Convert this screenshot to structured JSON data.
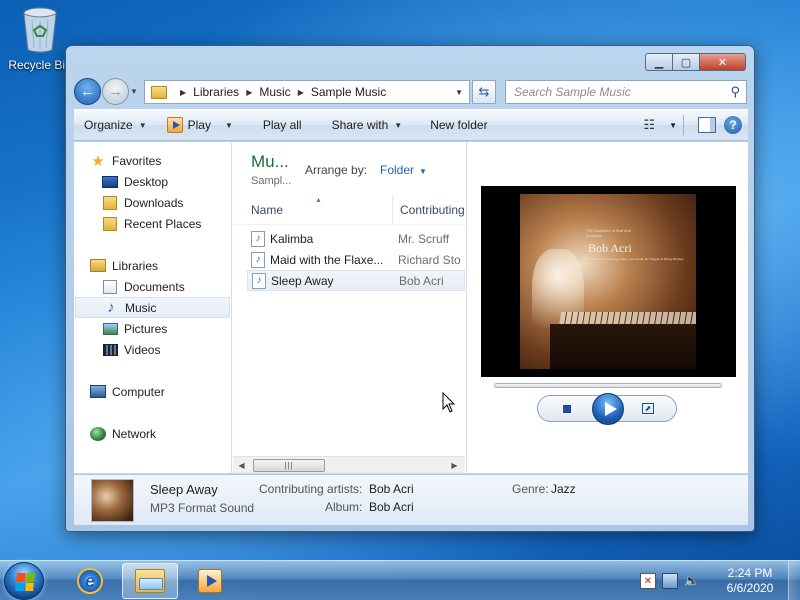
{
  "desktop": {
    "recycle_bin_label": "Recycle Bin"
  },
  "window": {
    "address": {
      "crumbs": [
        "Libraries",
        "Music",
        "Sample Music"
      ]
    },
    "search": {
      "placeholder": "Search Sample Music"
    },
    "toolbar": {
      "organize": "Organize",
      "play": "Play",
      "play_all": "Play all",
      "share_with": "Share with",
      "new_folder": "New folder"
    },
    "nav": {
      "favorites": "Favorites",
      "desktop": "Desktop",
      "downloads": "Downloads",
      "recent_places": "Recent Places",
      "libraries": "Libraries",
      "documents": "Documents",
      "music": "Music",
      "pictures": "Pictures",
      "videos": "Videos",
      "computer": "Computer",
      "network": "Network"
    },
    "library": {
      "title": "Mu...",
      "subtitle": "Sampl...",
      "arrange_by_label": "Arrange by:",
      "arrange_by_value": "Folder"
    },
    "columns": {
      "name": "Name",
      "contributing": "Contributing"
    },
    "files": [
      {
        "name": "Kalimba",
        "artist": "Mr. Scruff"
      },
      {
        "name": "Maid with the Flaxe...",
        "artist": "Richard Stoltzman"
      },
      {
        "name": "Sleep Away",
        "artist": "Bob Acri"
      }
    ],
    "selected_index": 2,
    "preview": {
      "album_artist": "Bob Acri",
      "album_small_top": "The Evolution of Bob Acri presents",
      "album_small_bottom": "with Glenn Ordin, George Mraz, Lew Soloff, Ed Thigpen & Randy Brecker"
    },
    "details": {
      "title": "Sleep Away",
      "type": "MP3 Format Sound",
      "contributing_label": "Contributing artists:",
      "contributing_value": "Bob Acri",
      "album_label": "Album:",
      "album_value": "Bob Acri",
      "genre_label": "Genre:",
      "genre_value": "Jazz"
    }
  },
  "taskbar": {
    "time": "2:24 PM",
    "date": "6/6/2020"
  },
  "colors": {
    "library_title": "#1e6b3a",
    "link_blue": "#2064b0",
    "desktop_blue": "#1e7fd6"
  }
}
